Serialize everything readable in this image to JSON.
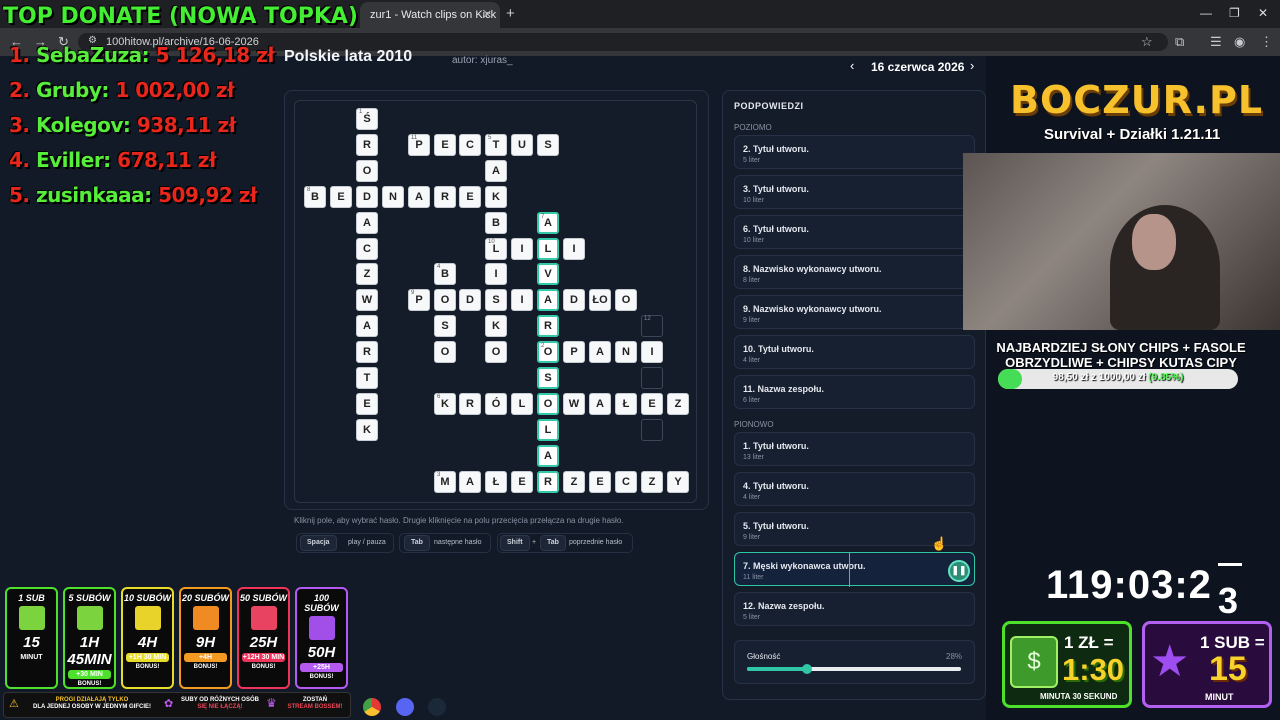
{
  "browser": {
    "tab_title": "zur1 - Watch clips on Kick",
    "url": "100hitow.pl/archive/16-06-2026"
  },
  "page": {
    "title": "Polskie lata 2010",
    "author": "autor: xjuras_",
    "date_label": "16 czerwca 2026",
    "prev": "‹",
    "next": "›",
    "hint_text": "Kliknij pole, aby wybrać hasło. Drugie kliknięcie na polu przecięcia przełącza na drugie hasło.",
    "keys": [
      {
        "key": "Spacja",
        "desc": "play / pauza"
      },
      {
        "key": "Tab",
        "desc": "następne hasło"
      },
      {
        "key1": "Shift",
        "plus": "+",
        "key2": "Tab",
        "desc": "poprzednie hasło"
      }
    ]
  },
  "hints": {
    "title": "PODPOWIEDZI",
    "across_label": "POZIOMO",
    "down_label": "PIONOWO",
    "across": [
      {
        "title": "2. Tytuł utworu.",
        "sub": "5 liter"
      },
      {
        "title": "3. Tytuł utworu.",
        "sub": "10 liter"
      },
      {
        "title": "6. Tytuł utworu.",
        "sub": "10 liter"
      },
      {
        "title": "8. Nazwisko wykonawcy utworu.",
        "sub": "8 liter"
      },
      {
        "title": "9. Nazwisko wykonawcy utworu.",
        "sub": "9 liter"
      },
      {
        "title": "10. Tytuł utworu.",
        "sub": "4 liter"
      },
      {
        "title": "11. Nazwa zespołu.",
        "sub": "6 liter"
      }
    ],
    "down": [
      {
        "title": "1. Tytuł utworu.",
        "sub": "13 liter"
      },
      {
        "title": "4. Tytuł utworu.",
        "sub": "4 liter"
      },
      {
        "title": "5. Tytuł utworu.",
        "sub": "9 liter"
      },
      {
        "title": "7. Męski wykonawca utworu.",
        "sub": "11 liter"
      },
      {
        "title": "12. Nazwa zespołu.",
        "sub": "5 liter"
      }
    ],
    "volume_label": "Głośność",
    "volume_value": "28%",
    "volume_fraction": 0.28
  },
  "crossword": {
    "cells": [
      {
        "r": 0,
        "c": 2,
        "ch": "Ś",
        "n": "1"
      },
      {
        "r": 1,
        "c": 2,
        "ch": "R"
      },
      {
        "r": 1,
        "c": 4,
        "ch": "P",
        "n": "11"
      },
      {
        "r": 1,
        "c": 5,
        "ch": "E"
      },
      {
        "r": 1,
        "c": 6,
        "ch": "C"
      },
      {
        "r": 1,
        "c": 7,
        "ch": "T",
        "n": "5"
      },
      {
        "r": 1,
        "c": 8,
        "ch": "U"
      },
      {
        "r": 1,
        "c": 9,
        "ch": "S"
      },
      {
        "r": 2,
        "c": 2,
        "ch": "O"
      },
      {
        "r": 2,
        "c": 7,
        "ch": "A"
      },
      {
        "r": 3,
        "c": 0,
        "ch": "B",
        "n": "8"
      },
      {
        "r": 3,
        "c": 1,
        "ch": "E"
      },
      {
        "r": 3,
        "c": 2,
        "ch": "D"
      },
      {
        "r": 3,
        "c": 3,
        "ch": "N"
      },
      {
        "r": 3,
        "c": 4,
        "ch": "A"
      },
      {
        "r": 3,
        "c": 5,
        "ch": "R"
      },
      {
        "r": 3,
        "c": 6,
        "ch": "E"
      },
      {
        "r": 3,
        "c": 7,
        "ch": "K"
      },
      {
        "r": 4,
        "c": 2,
        "ch": "A"
      },
      {
        "r": 4,
        "c": 7,
        "ch": "B"
      },
      {
        "r": 4,
        "c": 9,
        "ch": "A",
        "n": "7",
        "hl": true
      },
      {
        "r": 5,
        "c": 2,
        "ch": "C"
      },
      {
        "r": 5,
        "c": 7,
        "ch": "L",
        "n": "10"
      },
      {
        "r": 5,
        "c": 8,
        "ch": "I"
      },
      {
        "r": 5,
        "c": 9,
        "ch": "L",
        "hl": true
      },
      {
        "r": 5,
        "c": 10,
        "ch": "I"
      },
      {
        "r": 6,
        "c": 2,
        "ch": "Z"
      },
      {
        "r": 6,
        "c": 5,
        "ch": "B",
        "n": "4"
      },
      {
        "r": 6,
        "c": 7,
        "ch": "I"
      },
      {
        "r": 6,
        "c": 9,
        "ch": "V",
        "hl": true
      },
      {
        "r": 7,
        "c": 2,
        "ch": "W"
      },
      {
        "r": 7,
        "c": 4,
        "ch": "P",
        "n": "9"
      },
      {
        "r": 7,
        "c": 5,
        "ch": "O"
      },
      {
        "r": 7,
        "c": 6,
        "ch": "D"
      },
      {
        "r": 7,
        "c": 7,
        "ch": "S"
      },
      {
        "r": 7,
        "c": 8,
        "ch": "I"
      },
      {
        "r": 7,
        "c": 9,
        "ch": "A",
        "hl": true
      },
      {
        "r": 7,
        "c": 10,
        "ch": "D"
      },
      {
        "r": 7,
        "c": 11,
        "ch": "ŁO"
      },
      {
        "r": 7,
        "c": 12,
        "ch": "O"
      },
      {
        "r": 8,
        "c": 2,
        "ch": "A"
      },
      {
        "r": 8,
        "c": 5,
        "ch": "S"
      },
      {
        "r": 8,
        "c": 7,
        "ch": "K"
      },
      {
        "r": 8,
        "c": 9,
        "ch": "R",
        "hl": true
      },
      {
        "r": 8,
        "c": 13,
        "ch": "",
        "n": "12"
      },
      {
        "r": 9,
        "c": 2,
        "ch": "R"
      },
      {
        "r": 9,
        "c": 5,
        "ch": "O"
      },
      {
        "r": 9,
        "c": 7,
        "ch": "O"
      },
      {
        "r": 9,
        "c": 9,
        "ch": "O",
        "n": "2",
        "hl": true
      },
      {
        "r": 9,
        "c": 10,
        "ch": "P"
      },
      {
        "r": 9,
        "c": 11,
        "ch": "A"
      },
      {
        "r": 9,
        "c": 12,
        "ch": "N"
      },
      {
        "r": 9,
        "c": 13,
        "ch": "I"
      },
      {
        "r": 10,
        "c": 2,
        "ch": "T"
      },
      {
        "r": 10,
        "c": 9,
        "ch": "S",
        "hl": true
      },
      {
        "r": 10,
        "c": 13,
        "ch": ""
      },
      {
        "r": 11,
        "c": 2,
        "ch": "E"
      },
      {
        "r": 11,
        "c": 5,
        "ch": "K",
        "n": "6"
      },
      {
        "r": 11,
        "c": 6,
        "ch": "R"
      },
      {
        "r": 11,
        "c": 7,
        "ch": "Ó"
      },
      {
        "r": 11,
        "c": 8,
        "ch": "L"
      },
      {
        "r": 11,
        "c": 9,
        "ch": "O",
        "hl": true
      },
      {
        "r": 11,
        "c": 10,
        "ch": "W"
      },
      {
        "r": 11,
        "c": 11,
        "ch": "A"
      },
      {
        "r": 11,
        "c": 12,
        "ch": "Ł"
      },
      {
        "r": 11,
        "c": 13,
        "ch": "E"
      },
      {
        "r": 11,
        "c": 14,
        "ch": "Z"
      },
      {
        "r": 12,
        "c": 2,
        "ch": "K"
      },
      {
        "r": 12,
        "c": 9,
        "ch": "L",
        "hl": true
      },
      {
        "r": 12,
        "c": 13,
        "ch": ""
      },
      {
        "r": 13,
        "c": 9,
        "ch": "A",
        "hl": true
      },
      {
        "r": 14,
        "c": 5,
        "ch": "M",
        "n": "3"
      },
      {
        "r": 14,
        "c": 6,
        "ch": "A"
      },
      {
        "r": 14,
        "c": 7,
        "ch": "Ł"
      },
      {
        "r": 14,
        "c": 8,
        "ch": "E"
      },
      {
        "r": 14,
        "c": 9,
        "ch": "R",
        "hl": true
      },
      {
        "r": 14,
        "c": 10,
        "ch": "Z"
      },
      {
        "r": 14,
        "c": 11,
        "ch": "E"
      },
      {
        "r": 14,
        "c": 12,
        "ch": "C"
      },
      {
        "r": 14,
        "c": 13,
        "ch": "Z"
      },
      {
        "r": 14,
        "c": 14,
        "ch": "Y"
      }
    ]
  },
  "overlay": {
    "top_donate": "TOP DONATE (NOWA TOPKA)",
    "donors": [
      {
        "rank": "1.",
        "name": "SebaZuza:",
        "amount": "5 126,18 zł"
      },
      {
        "rank": "2.",
        "name": "Gruby:",
        "amount": "1 002,00 zł"
      },
      {
        "rank": "3.",
        "name": "Kolegov:",
        "amount": "938,11 zł"
      },
      {
        "rank": "4.",
        "name": "Eviller:",
        "amount": "678,11 zł"
      },
      {
        "rank": "5.",
        "name": "zusinkaaa:",
        "amount": "509,92 zł"
      }
    ],
    "brand": "BOCZUR.PL",
    "brand_sub": "Survival + Działki 1.21.11",
    "goal_title": "NAJBARDZIEJ SŁONY CHIPS + FASOLE OBRZYDLIWE + CHIPSY KUTAS CIPY",
    "goal_text": "98,50 zł z 1000,00 zł",
    "goal_pct": "(9.85%)",
    "goal_fraction": 0.0985,
    "timer": "119:03:2",
    "timer_last": "3",
    "zl_top": "1 ZŁ =",
    "zl_big": "1:30",
    "zl_bot": "MINUTA 30 SEKUND",
    "sub_top": "1 SUB =",
    "sub_big": "15",
    "sub_bot": "MINUT",
    "gifts": [
      {
        "head": "1 SUB",
        "time": "15",
        "bonus": "MINUT",
        "note": "",
        "color": "#4ee12c",
        "ic": "#7bd33d"
      },
      {
        "head": "5 SUBÓW",
        "time": "1H 45MIN",
        "bonus": "+30 MIN",
        "note": "BONUS!",
        "color": "#4ee12c",
        "ic": "#7bd33d"
      },
      {
        "head": "10 SUBÓW",
        "time": "4H",
        "bonus": "+1H 30 MIN",
        "note": "BONUS!",
        "color": "#e8dc2a",
        "ic": "#e8d32a"
      },
      {
        "head": "20 SUBÓW",
        "time": "9H",
        "bonus": "+4H",
        "note": "BONUS!",
        "color": "#f39a22",
        "ic": "#f08a22"
      },
      {
        "head": "50 SUBÓW",
        "time": "25H",
        "bonus": "+12H 30 MIN",
        "note": "BONUS!",
        "color": "#f0335a",
        "ic": "#e84462"
      },
      {
        "head": "100 SUBÓW",
        "time": "50H",
        "bonus": "+25H",
        "note": "BONUS!",
        "color": "#b45af2",
        "ic": "#a24ee8"
      }
    ],
    "info1a": "PROGI DZIAŁAJĄ TYLKO",
    "info1b": "DLA JEDNEJ OSOBY W JEDNYM GIFCIE!",
    "info2a": "SUBY OD RÓŻNYCH OSÓB",
    "info2b": "SIĘ NIE ŁĄCZĄ!",
    "info3a": "ZOSTAŃ",
    "info3b": "STREAM BOSSEM!"
  }
}
